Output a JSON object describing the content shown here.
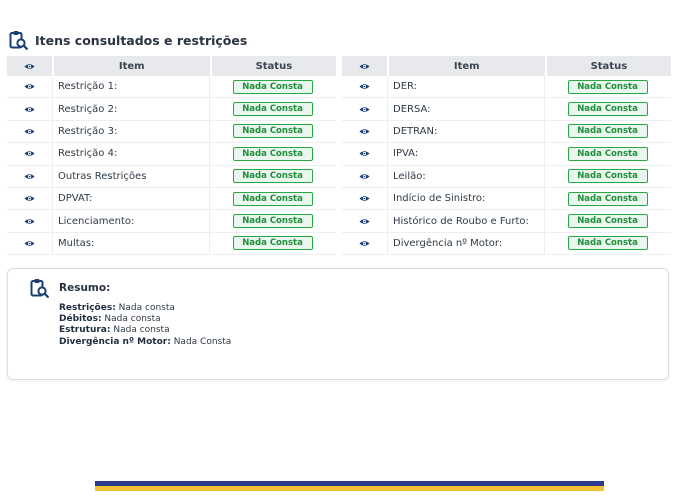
{
  "header": {
    "title": "Itens consultados e restrições"
  },
  "table_headers": {
    "item": "Item",
    "status": "Status"
  },
  "left_table": [
    {
      "item": "Restrição 1:",
      "status": "Nada Consta"
    },
    {
      "item": "Restrição 2:",
      "status": "Nada Consta"
    },
    {
      "item": "Restrição 3:",
      "status": "Nada Consta"
    },
    {
      "item": "Restrição 4:",
      "status": "Nada Consta"
    },
    {
      "item": "Outras Restrições",
      "status": "Nada Consta"
    },
    {
      "item": "DPVAT:",
      "status": "Nada Consta"
    },
    {
      "item": "Licenciamento:",
      "status": "Nada Consta"
    },
    {
      "item": "Multas:",
      "status": "Nada Consta"
    }
  ],
  "right_table": [
    {
      "item": "DER:",
      "status": "Nada Consta"
    },
    {
      "item": "DERSA:",
      "status": "Nada Consta"
    },
    {
      "item": "DETRAN:",
      "status": "Nada Consta"
    },
    {
      "item": "IPVA:",
      "status": "Nada Consta"
    },
    {
      "item": "Leilão:",
      "status": "Nada Consta"
    },
    {
      "item": "Indício de Sinistro:",
      "status": "Nada Consta"
    },
    {
      "item": "Histórico de Roubo e Furto:",
      "status": "Nada Consta"
    },
    {
      "item": "Divergência nº Motor:",
      "status": "Nada Consta"
    }
  ],
  "summary": {
    "title": "Resumo:",
    "lines": [
      {
        "label": "Restrições:",
        "value": "Nada consta"
      },
      {
        "label": "Débitos:",
        "value": "Nada consta"
      },
      {
        "label": "Estrutura:",
        "value": "Nada consta"
      },
      {
        "label": "Divergência nº Motor:",
        "value": "Nada Consta"
      }
    ]
  },
  "colors": {
    "badge_border": "#29a745",
    "badge_text": "#1f8f3a",
    "icon_blue": "#1b3f73",
    "footer_blue": "#2b3a8c",
    "footer_yellow": "#f2c230"
  },
  "icons": {
    "header": "clipboard-search-icon",
    "row": "eye-icon",
    "column_header": "eye-icon"
  }
}
